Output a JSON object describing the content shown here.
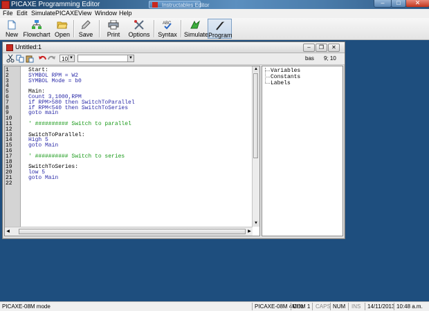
{
  "window": {
    "title": "PICAXE Programming Editor",
    "inactive_tab": "Instructables Editor"
  },
  "menu": [
    "File",
    "Edit",
    "Simulate",
    "PICAXE",
    "View",
    "Window",
    "Help"
  ],
  "toolbar": [
    {
      "label": "New",
      "icon": "new-document-icon"
    },
    {
      "label": "Flowchart",
      "icon": "flowchart-icon"
    },
    {
      "label": "Open",
      "icon": "open-folder-icon"
    },
    {
      "label": "Save",
      "icon": "save-pen-icon"
    },
    {
      "label": "Print",
      "icon": "printer-icon"
    },
    {
      "label": "Options",
      "icon": "tools-icon"
    },
    {
      "label": "Syntax",
      "icon": "abc-check-icon"
    },
    {
      "label": "Simulate",
      "icon": "simulate-icon"
    },
    {
      "label": "Program",
      "icon": "program-icon"
    }
  ],
  "document": {
    "title": "Untitled:1",
    "font_size": "10",
    "font_name": "",
    "mode": "bas",
    "cursor_pos": "9; 10"
  },
  "code_lines": [
    {
      "n": "1",
      "text": "Start:",
      "style": "label"
    },
    {
      "n": "2",
      "text": "SYMBOL RPM = W2",
      "style": "kw"
    },
    {
      "n": "3",
      "text": "SYMBOL Mode = b0",
      "style": "kw"
    },
    {
      "n": "4",
      "text": "",
      "style": "label"
    },
    {
      "n": "5",
      "text": "Main:",
      "style": "label"
    },
    {
      "n": "6",
      "text": "Count 3,1000,RPM",
      "style": "kw"
    },
    {
      "n": "7",
      "text": "if RPM>580 then SwitchToParallel",
      "style": "kw"
    },
    {
      "n": "8",
      "text": "if RPM<540 then SwitchToSeries",
      "style": "kw"
    },
    {
      "n": "9",
      "text": "goto main",
      "style": "kw"
    },
    {
      "n": "10",
      "text": "",
      "style": "label"
    },
    {
      "n": "11",
      "text": "' ########## Switch to parallel",
      "style": "cm"
    },
    {
      "n": "12",
      "text": "",
      "style": "label"
    },
    {
      "n": "13",
      "text": "SwitchToParallel:",
      "style": "label"
    },
    {
      "n": "14",
      "text": "High 5",
      "style": "kw"
    },
    {
      "n": "15",
      "text": "goto Main",
      "style": "kw"
    },
    {
      "n": "16",
      "text": "",
      "style": "label"
    },
    {
      "n": "17",
      "text": "' ########## Switch to series",
      "style": "cm"
    },
    {
      "n": "18",
      "text": "",
      "style": "label"
    },
    {
      "n": "19",
      "text": "SwitchToSeries:",
      "style": "label"
    },
    {
      "n": "20",
      "text": "low 5",
      "style": "kw"
    },
    {
      "n": "21",
      "text": "goto Main",
      "style": "kw"
    },
    {
      "n": "22",
      "text": "",
      "style": "label"
    }
  ],
  "tree": [
    "Variables",
    "Constants",
    "Labels"
  ],
  "statusbar": {
    "mode": "PICAXE-08M mode",
    "chip": "PICAXE-08M 4MHz",
    "port": "COM 1",
    "caps": "CAPS",
    "num": "NUM",
    "ins": "INS",
    "date": "14/11/2013",
    "time": "10:48 a.m."
  },
  "colors": {
    "keyword": "#2a2aa8",
    "comment": "#1a9a1a",
    "desktop": "#1e4e7e"
  }
}
